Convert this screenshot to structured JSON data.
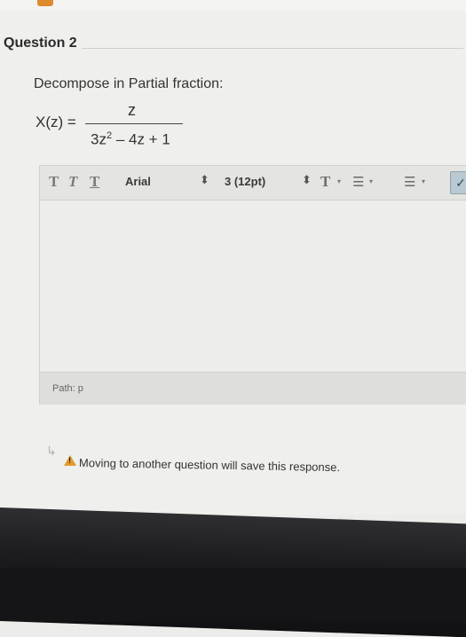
{
  "question": {
    "title": "Question 2",
    "prompt": "Decompose in Partial fraction:",
    "formula": {
      "lhs": "X(z) =",
      "numerator": "z",
      "denominator_base": "3z",
      "denominator_exp": "2",
      "denominator_rest": " – 4z + 1"
    }
  },
  "toolbar": {
    "bold_label": "T",
    "italic_label": "T",
    "underline_label": "T",
    "font_family": "Arial",
    "font_size": "3 (12pt)",
    "select_arrow": "⬍",
    "text_color_label": "T",
    "dropdown_caret": "▾",
    "bullet_list": "☰",
    "number_list": "☰",
    "spell_check": "✓"
  },
  "editor": {
    "path_label": "Path: p"
  },
  "notice": {
    "text": "Moving to another question will save this response.",
    "icon": "warning-icon",
    "icon_glyph": "!"
  },
  "colors": {
    "warning": "#e39a2a",
    "accent_tab": "#e08a2e"
  }
}
